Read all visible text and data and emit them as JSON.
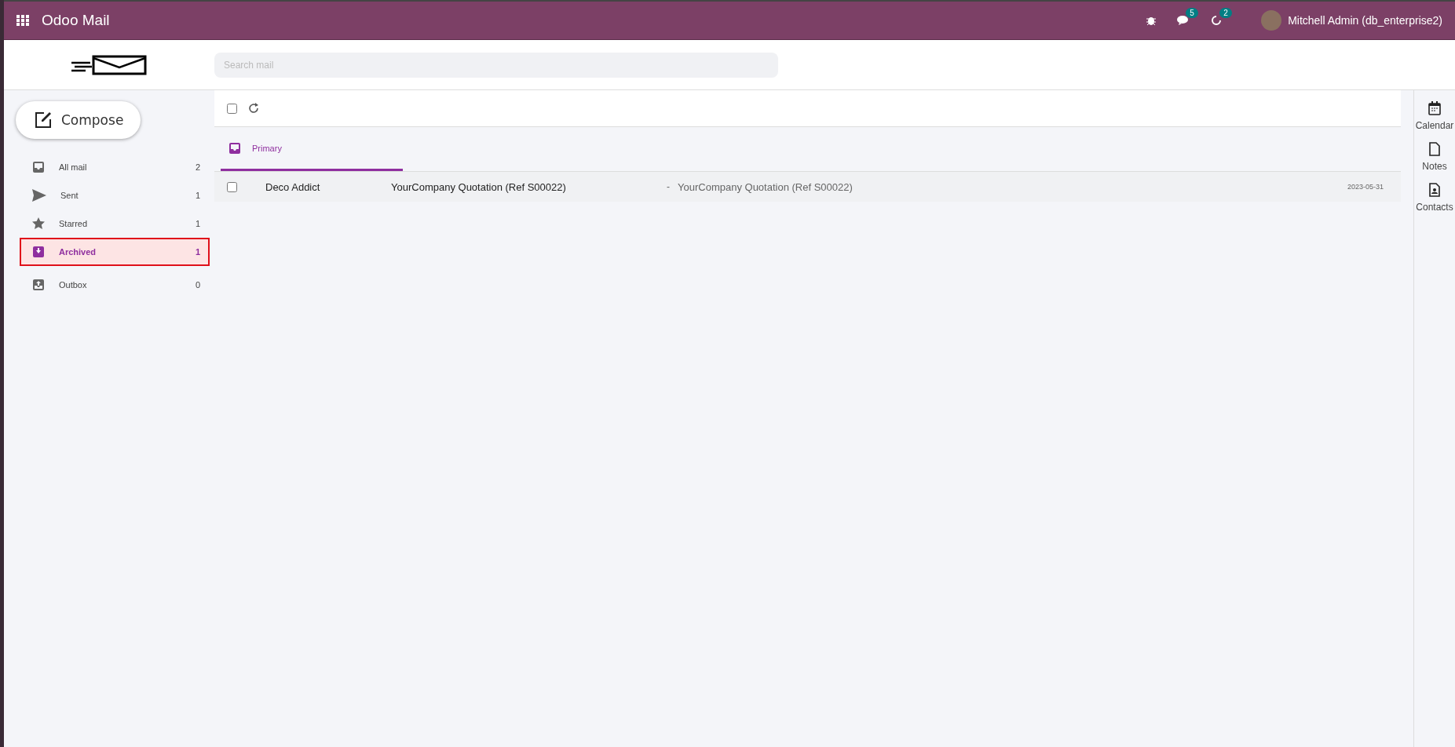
{
  "navbar": {
    "app_title": "Odoo Mail",
    "messages_count": "5",
    "activities_count": "2",
    "user": "Mitchell Admin (db_enterprise2)"
  },
  "search": {
    "placeholder": "Search mail"
  },
  "compose": "Compose",
  "folders": [
    {
      "kind": "inbox",
      "label": "All mail",
      "count": "2",
      "selected": false
    },
    {
      "kind": "sent",
      "label": "Sent",
      "count": "1",
      "selected": false
    },
    {
      "kind": "starred",
      "label": "Starred",
      "count": "1",
      "selected": false
    },
    {
      "kind": "archived",
      "label": "Archived",
      "count": "1",
      "selected": true
    },
    {
      "kind": "outbox",
      "label": "Outbox",
      "count": "0",
      "selected": false
    }
  ],
  "select_all": {
    "checked": false
  },
  "tabs": [
    {
      "label": "Primary",
      "selected": true
    }
  ],
  "messages": [
    {
      "checked": false,
      "sender": "Deco Addict",
      "subject": "YourCompany Quotation (Ref S00022)",
      "separator": "-",
      "preview": "YourCompany Quotation (Ref S00022)",
      "date": "2023-05-31"
    }
  ],
  "side_apps": [
    {
      "kind": "calendar",
      "label": "Calendar"
    },
    {
      "kind": "notes",
      "label": "Notes"
    },
    {
      "kind": "contacts",
      "label": "Contacts"
    }
  ]
}
